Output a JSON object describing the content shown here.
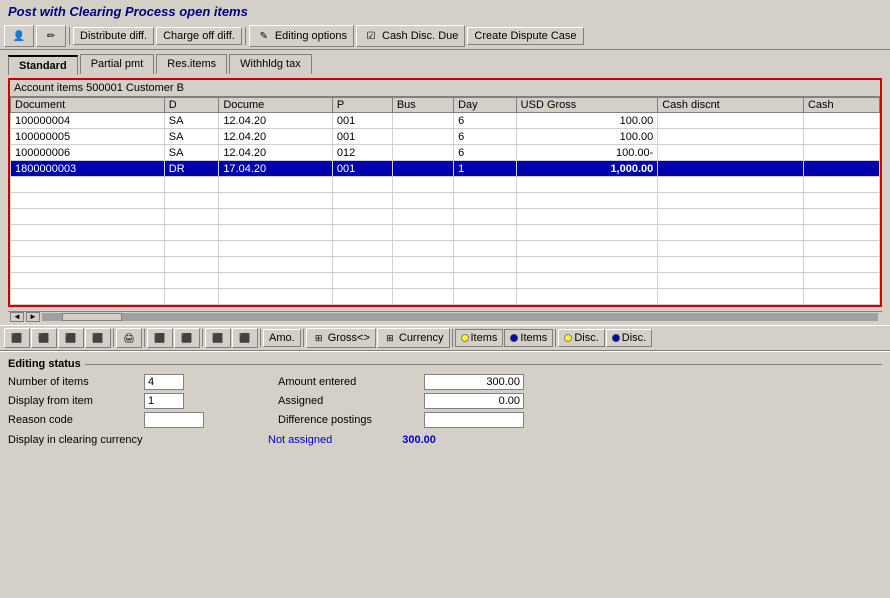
{
  "title": "Post with Clearing Process open items",
  "toolbar": {
    "buttons": [
      {
        "label": "Distribute diff.",
        "icon": "⊞",
        "name": "distribute-diff-button"
      },
      {
        "label": "Charge off diff.",
        "icon": "⊟",
        "name": "charge-off-diff-button"
      },
      {
        "label": "Editing options",
        "icon": "✎",
        "name": "editing-options-button"
      },
      {
        "label": "Cash Disc. Due",
        "icon": "☑",
        "name": "cash-disc-due-button"
      },
      {
        "label": "Create Dispute Case",
        "icon": "",
        "name": "create-dispute-case-button"
      }
    ]
  },
  "tabs": [
    {
      "label": "Standard",
      "active": true,
      "name": "tab-standard"
    },
    {
      "label": "Partial pmt",
      "active": false,
      "name": "tab-partial-pmt"
    },
    {
      "label": "Res.items",
      "active": false,
      "name": "tab-res-items"
    },
    {
      "label": "Withhldg tax",
      "active": false,
      "name": "tab-withhldg-tax"
    }
  ],
  "account_section": {
    "header": "Account items 500001 Customer B",
    "columns": [
      {
        "label": "Document",
        "name": "col-document"
      },
      {
        "label": "D",
        "name": "col-d"
      },
      {
        "label": "Docume",
        "name": "col-docume"
      },
      {
        "label": "P",
        "name": "col-p"
      },
      {
        "label": "Bus",
        "name": "col-bus"
      },
      {
        "label": "Day",
        "name": "col-day"
      },
      {
        "label": "USD Gross",
        "name": "col-usd-gross"
      },
      {
        "label": "Cash discnt",
        "name": "col-cash-discnt"
      },
      {
        "label": "Cash",
        "name": "col-cash"
      }
    ],
    "rows": [
      {
        "document": "100000004",
        "d": "SA",
        "docume": "12.04.20",
        "p": "001",
        "bus": "",
        "day": "6",
        "usd_gross": "100.00",
        "cash_discnt": "",
        "cash": "",
        "highlight": false
      },
      {
        "document": "100000005",
        "d": "SA",
        "docume": "12.04.20",
        "p": "001",
        "bus": "",
        "day": "6",
        "usd_gross": "100.00",
        "cash_discnt": "",
        "cash": "",
        "highlight": false
      },
      {
        "document": "100000006",
        "d": "SA",
        "docume": "12.04.20",
        "p": "012",
        "bus": "",
        "day": "6",
        "usd_gross": "100.00-",
        "cash_discnt": "",
        "cash": "",
        "highlight": false
      },
      {
        "document": "1800000003",
        "d": "DR",
        "docume": "17.04.20",
        "p": "001",
        "bus": "",
        "day": "1",
        "usd_gross": "1,000.00",
        "cash_discnt": "",
        "cash": "",
        "highlight": true
      }
    ]
  },
  "bottom_toolbar": {
    "icon_buttons": [
      "⬛",
      "⬛",
      "⬛",
      "⬛",
      "🖨",
      "⬛",
      "⬛"
    ],
    "amo_label": "Amo.",
    "gross_label": "Gross<>",
    "currency_label": "Currency",
    "items1_label": "Items",
    "items2_label": "Items",
    "disc1_label": "Disc.",
    "disc2_label": "Disc."
  },
  "editing_status": {
    "title": "Editing status",
    "number_of_items_label": "Number of items",
    "number_of_items_value": "4",
    "display_from_item_label": "Display from item",
    "display_from_item_value": "1",
    "reason_code_label": "Reason code",
    "reason_code_value": "",
    "amount_entered_label": "Amount entered",
    "amount_entered_value": "300.00",
    "assigned_label": "Assigned",
    "assigned_value": "0.00",
    "difference_postings_label": "Difference postings",
    "difference_postings_value": "",
    "display_in_clearing_label": "Display in clearing currency",
    "not_assigned_label": "Not assigned",
    "clearing_amount": "300.00"
  }
}
